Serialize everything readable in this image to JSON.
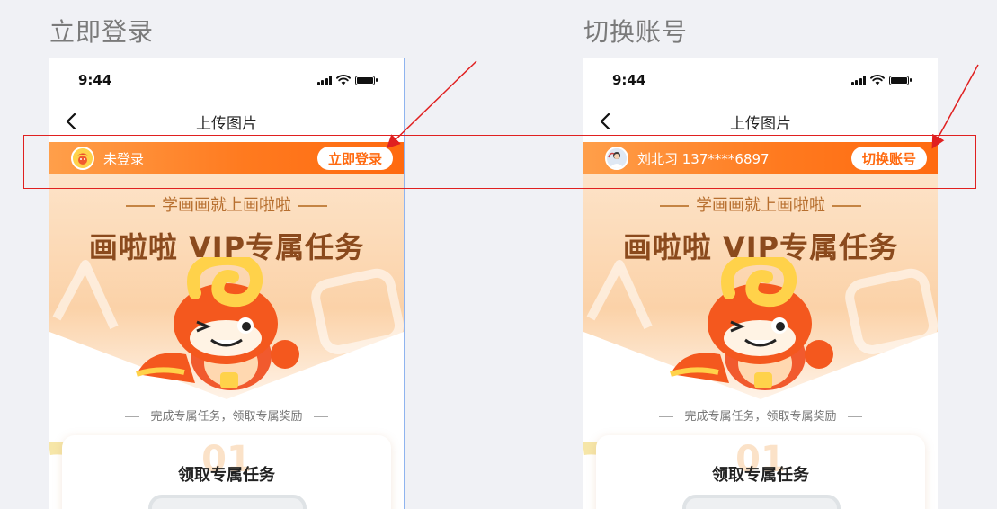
{
  "left": {
    "heading": "立即登录",
    "time": "9:44",
    "nav_title": "上传图片",
    "user_text": "未登录",
    "button_label": "立即登录"
  },
  "right": {
    "heading": "切换账号",
    "time": "9:44",
    "nav_title": "上传图片",
    "user_text": "刘北习 137****6897",
    "button_label": "切换账号"
  },
  "hero": {
    "slogan": "学画画就上画啦啦",
    "vip_title": "画啦啦 VIP专属任务",
    "subtitle": "完成专属任务，领取专属奖励",
    "card_number": "01",
    "card_title": "领取专属任务"
  },
  "colors": {
    "accent_orange": "#ff7a1f",
    "annotation_red": "#e02020",
    "frame_blue": "#8fb4ef"
  },
  "icons": {
    "back": "chevron-left-icon",
    "signal": "signal-icon",
    "wifi": "wifi-icon",
    "battery": "battery-icon",
    "avatar": "avatar-icon"
  }
}
